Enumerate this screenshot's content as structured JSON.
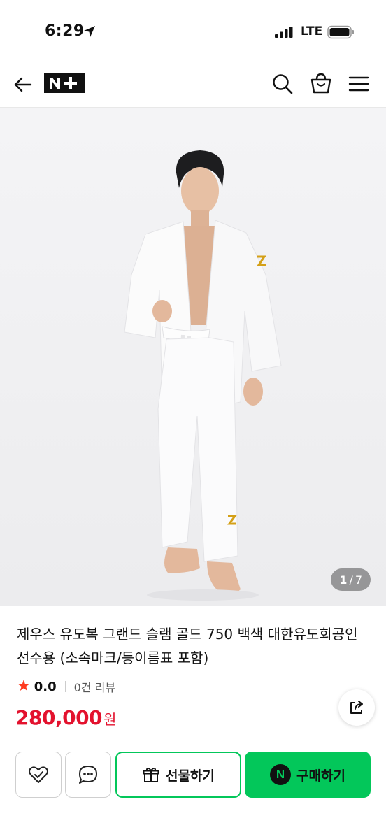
{
  "status_bar": {
    "time": "6:29",
    "carrier": "LTE"
  },
  "header": {
    "logo_text": "N+",
    "icons": [
      "back-arrow-icon",
      "search-icon",
      "shopping-bag-icon",
      "hamburger-menu-icon"
    ]
  },
  "product": {
    "image_index": "1",
    "image_total": "7",
    "title": "제우스 유도복 그랜드 슬램 골드 750 백색 대한유도회공인 선수용 (소속마크/등이름표 포함)",
    "rating": "0.0",
    "review_count": "0건 리뷰",
    "price": "280,000",
    "price_unit": "원"
  },
  "actions": {
    "gift_label": "선물하기",
    "buy_label": "구매하기",
    "npay_letter": "N"
  },
  "colors": {
    "accent_green": "#03c75a",
    "price_red": "#e3122e",
    "star_red": "#ff3b1f"
  }
}
